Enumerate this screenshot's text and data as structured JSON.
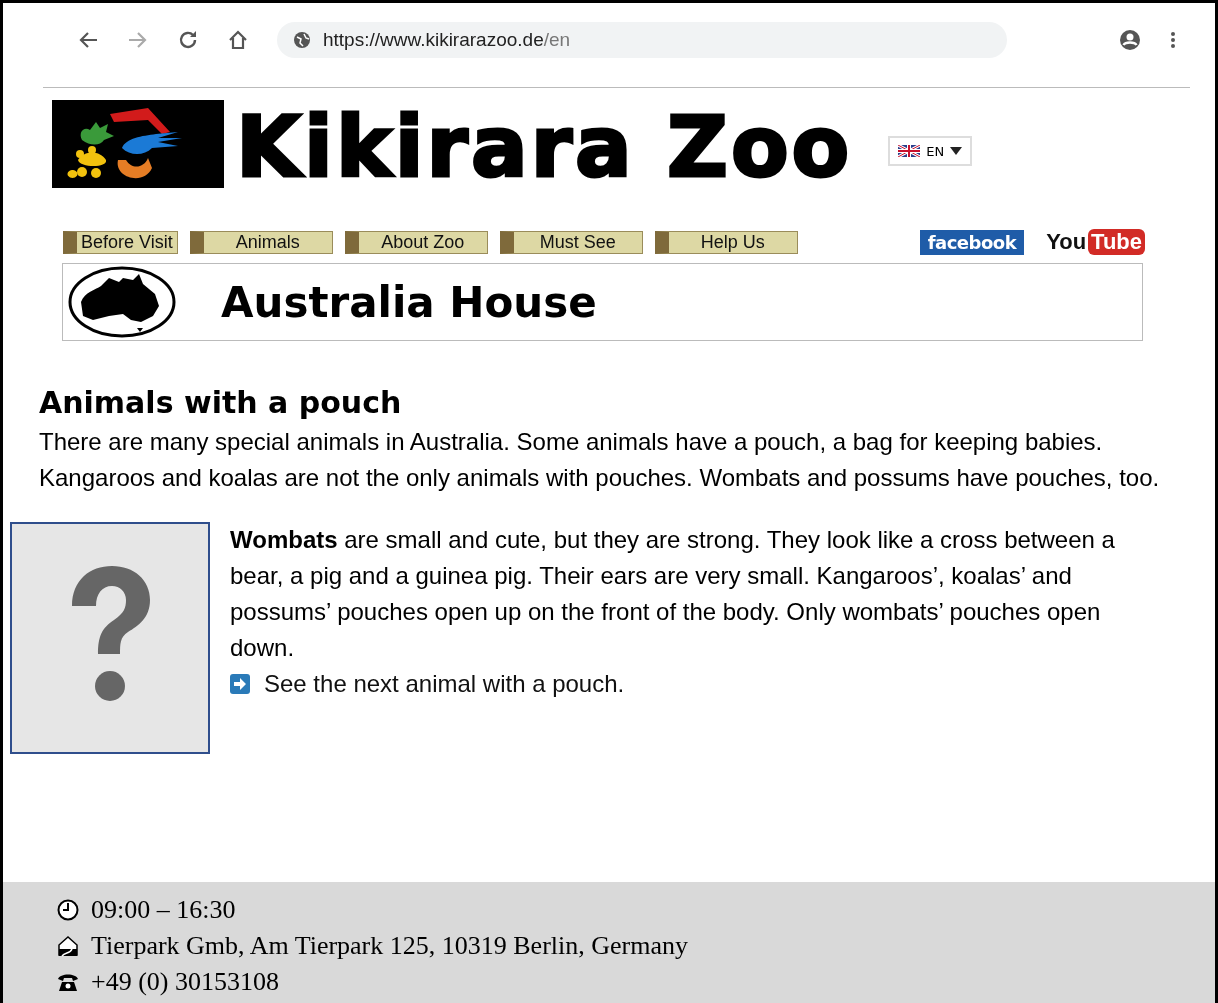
{
  "browser": {
    "url_host": "https://www.kikirarazoo.de",
    "url_path": "/en"
  },
  "header": {
    "title": "Kikirara Zoo",
    "language": "EN"
  },
  "nav": [
    {
      "label": "Before Visit"
    },
    {
      "label": "Animals"
    },
    {
      "label": "About Zoo"
    },
    {
      "label": "Must See"
    },
    {
      "label": "Help Us"
    }
  ],
  "social": {
    "facebook": "facebook",
    "youtube_left": "You",
    "youtube_right": "Tube"
  },
  "banner": {
    "title": "Australia House"
  },
  "intro": {
    "heading": "Animals with a pouch",
    "text": "There are many special animals in Australia. Some animals have a pouch, a bag for keeping babies. Kangaroos and koalas are not the only animals with pouches. Wombats and possums have pouches, too."
  },
  "animal": {
    "text": "**Wombats** are small and cute, but they are strong. They look like a cross between a bear, a pig and a guinea pig. Their ears are very small. Kangaroos’, koalas’ and possums’ pouches open up on the front of the body. Only wombats’ pouches open down.",
    "next_link": "See the next animal with a pouch."
  },
  "footer": [
    {
      "kind": "hours",
      "text": "09:00 – 16:30"
    },
    {
      "kind": "address",
      "text": "Tierpark Gmb, Am Tierpark 125, 10319 Berlin, Germany"
    },
    {
      "kind": "phone",
      "text": "+49 (0) 30153108"
    }
  ]
}
